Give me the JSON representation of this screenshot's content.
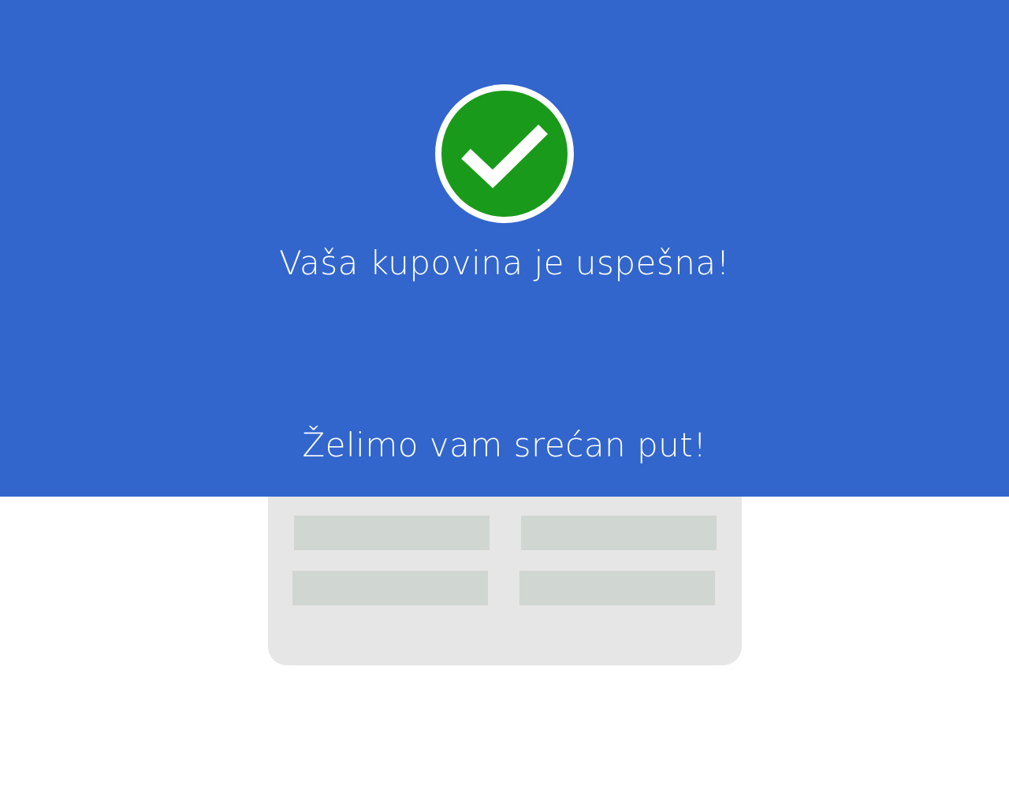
{
  "colors": {
    "hero_background": "#3366cc",
    "success_green": "#1a9a1a",
    "card_background": "#e6e6e6",
    "placeholder": "#d0d6d2"
  },
  "status": {
    "icon": "check-circle-icon",
    "title": "Vaša kupovina je uspešna!",
    "farewell": "Želimo vam srećan put!"
  },
  "ticket": {
    "placeholders": 4
  }
}
